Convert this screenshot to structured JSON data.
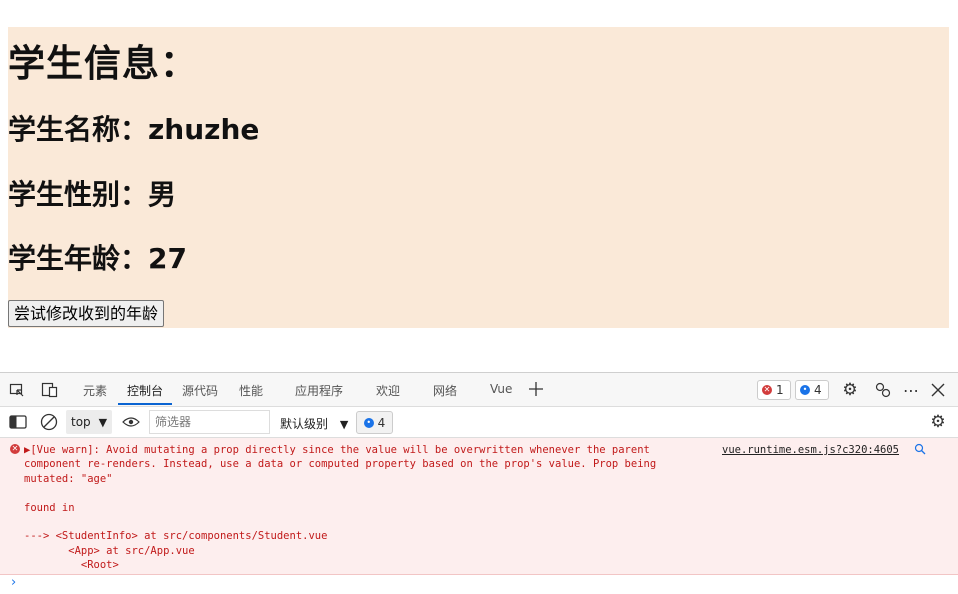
{
  "student": {
    "heading": "学生信息：",
    "name_line": "学生名称：zhuzhe",
    "sex_line": "学生性别：男",
    "age_line": "学生年龄：27",
    "button_label": "尝试修改收到的年龄"
  },
  "devtools": {
    "tabs": [
      "元素",
      "控制台",
      "源代码",
      "性能",
      "应用程序",
      "欢迎",
      "网络",
      "Vue"
    ],
    "active_tab": "控制台",
    "error_count": "1",
    "message_count": "4",
    "context": "top",
    "filter_placeholder": "筛选器",
    "levels_label": "默认级别",
    "toolbar_message_count": "4",
    "console": {
      "error_message": "▶[Vue warn]: Avoid mutating a prop directly since the value will be overwritten whenever the parent\ncomponent re-renders. Instead, use a data or computed property based on the prop's value. Prop being\nmutated: \"age\"\n\nfound in\n\n---> <StudentInfo> at src/components/Student.vue\n       <App> at src/App.vue\n         <Root>",
      "source_link": "vue.runtime.esm.js?c320:4605"
    },
    "prompt_symbol": "›"
  },
  "icons": [
    "inspect-icon",
    "device-icon",
    "add-tab-icon",
    "settings-icon",
    "connect-icon",
    "more-icon",
    "close-icon",
    "sidebar-icon",
    "clear-icon",
    "eye-icon",
    "search-icon"
  ],
  "colors": {
    "student_bg": "#fae9d8",
    "error_bg": "#fdeeee",
    "error_text": "#c11a1a",
    "accent": "#0a64d2"
  }
}
